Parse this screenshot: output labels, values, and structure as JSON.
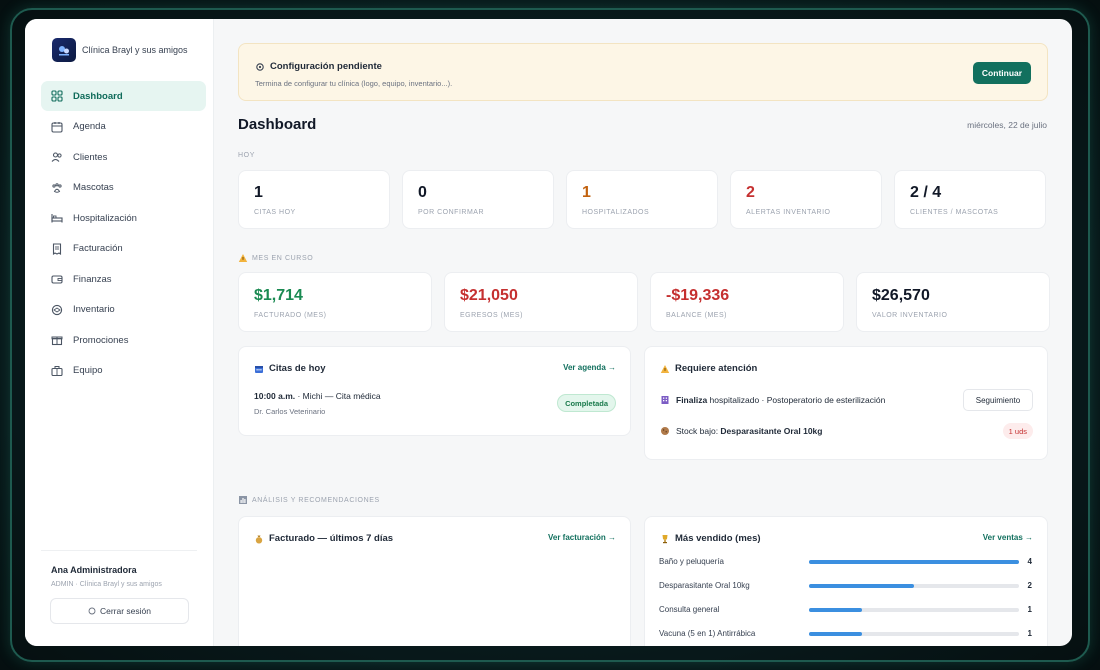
{
  "brand": {
    "name": "Clínica Brayl y sus amigos"
  },
  "nav": [
    {
      "label": "Dashboard",
      "icon": "grid-icon",
      "active": true
    },
    {
      "label": "Agenda",
      "icon": "calendar-icon"
    },
    {
      "label": "Clientes",
      "icon": "users-icon"
    },
    {
      "label": "Mascotas",
      "icon": "paw-icon"
    },
    {
      "label": "Hospitalización",
      "icon": "bed-icon"
    },
    {
      "label": "Facturación",
      "icon": "receipt-icon"
    },
    {
      "label": "Finanzas",
      "icon": "wallet-icon"
    },
    {
      "label": "Inventario",
      "icon": "box-icon"
    },
    {
      "label": "Promociones",
      "icon": "gift-icon"
    },
    {
      "label": "Equipo",
      "icon": "briefcase-icon"
    }
  ],
  "user": {
    "name": "Ana Administradora",
    "role": "ADMIN · Clínica Brayl y sus amigos",
    "logout_label": "Cerrar sesión"
  },
  "banner": {
    "title": "Configuración pendiente",
    "subtitle": "Termina de configurar tu clínica (logo, equipo, inventario...).",
    "button": "Continuar"
  },
  "header": {
    "title": "Dashboard",
    "date": "miércoles, 22 de julio"
  },
  "today": {
    "label": "HOY",
    "stats": [
      {
        "value": "1",
        "label": "CITAS HOY",
        "color": "#111827"
      },
      {
        "value": "0",
        "label": "POR CONFIRMAR",
        "color": "#111827"
      },
      {
        "value": "1",
        "label": "HOSPITALIZADOS",
        "color": "#c2620f"
      },
      {
        "value": "2",
        "label": "ALERTAS INVENTARIO",
        "color": "#c53030"
      },
      {
        "value": "2 / 4",
        "label": "CLIENTES / MASCOTAS",
        "color": "#111827"
      }
    ]
  },
  "month": {
    "label": "MES EN CURSO",
    "stats": [
      {
        "value": "$1,714",
        "label": "FACTURADO (MES)",
        "color": "#1a8a52"
      },
      {
        "value": "$21,050",
        "label": "EGRESOS (MES)",
        "color": "#c53030"
      },
      {
        "value": "-$19,336",
        "label": "BALANCE (MES)",
        "color": "#c53030"
      },
      {
        "value": "$26,570",
        "label": "VALOR INVENTARIO",
        "color": "#111827"
      }
    ]
  },
  "appointments": {
    "title": "Citas de hoy",
    "link": "Ver agenda →",
    "items": [
      {
        "time": "10:00 a.m.",
        "detail": " · Michi — Cita médica",
        "doctor": "Dr. Carlos Veterinario",
        "status": "Completada"
      }
    ]
  },
  "attention": {
    "title": "Requiere atención",
    "items": [
      {
        "strong": "Finaliza",
        "text": " hospitalizado · Postoperatorio de esterilización",
        "action": "Seguimiento"
      },
      {
        "prefix": "Stock bajo: ",
        "strong": "Desparasitante Oral 10kg",
        "badge": "1 uds"
      }
    ]
  },
  "analysis": {
    "label": "ANÁLISIS Y RECOMENDACIONES"
  },
  "billing_chart": {
    "title": "Facturado — últimos 7 días",
    "link": "Ver facturación →"
  },
  "top_sold": {
    "title": "Más vendido (mes)",
    "link": "Ver ventas →",
    "items": [
      {
        "name": "Baño y peluquería",
        "count": "4",
        "fraction": 1.0
      },
      {
        "name": "Desparasitante Oral 10kg",
        "count": "2",
        "fraction": 0.5
      },
      {
        "name": "Consulta general",
        "count": "1",
        "fraction": 0.25
      },
      {
        "name": "Vacuna (5 en 1) Antirrábica",
        "count": "1",
        "fraction": 0.25
      }
    ]
  }
}
